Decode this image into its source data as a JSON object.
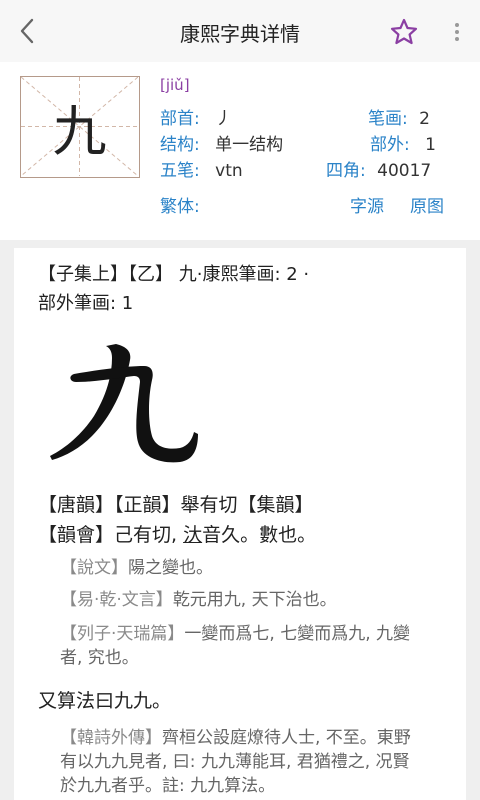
{
  "header": {
    "title": "康熙字典详情"
  },
  "char": {
    "glyph": "九",
    "pinyin": "[jiǔ]"
  },
  "details": {
    "bushou_label": "部首:",
    "bushou_value": "丿",
    "bihua_label": "笔画:",
    "bihua_value": "2",
    "jiegou_label": "结构:",
    "jiegou_value": "单一结构",
    "buwai_label": "部外:",
    "buwai_value": "1",
    "wubi_label": "五笔:",
    "wubi_value": "vtn",
    "sijiao_label": "四角:",
    "sijiao_value": "40017",
    "fanti_label": "繁体:",
    "ziyuan_link": "字源",
    "yuantu_link": "原图"
  },
  "entry": {
    "header_line1": "【子集上】【乙】 九·康熙筆画: 2  ·",
    "header_line2": "部外筆画: 1",
    "para1_line1": "【唐韻】【正韻】舉有切【集韻】",
    "para1_pre": "【韻會】己有切, ",
    "para1_under": "汏",
    "para1_post": "音久。數也。",
    "q1_src": "【說文】",
    "q1_text": "陽之變也。",
    "q2_src": "【易·乾·文言】",
    "q2_text": "乾元用九, 天下治也。",
    "q3_src": "【列子·天瑞篇】",
    "q3_text": "一變而爲七, 七變而爲九, 九變者, 究也。",
    "para2": "又算法曰九九。",
    "q4_src": "【韓詩外傳】",
    "q4_text": "齊桓公設庭燎待人士, 不至。東野有以九九見者, 曰: 九九薄能耳, 君猶禮之, 况賢於九九者乎。註: 九九算法。"
  },
  "colors": {
    "accent_purple": "#8b3fa3",
    "label_blue": "#2b83c8"
  },
  "icons": {
    "back": "chevron-left-icon",
    "favorite": "star-outline-icon",
    "more": "more-vert-icon"
  }
}
